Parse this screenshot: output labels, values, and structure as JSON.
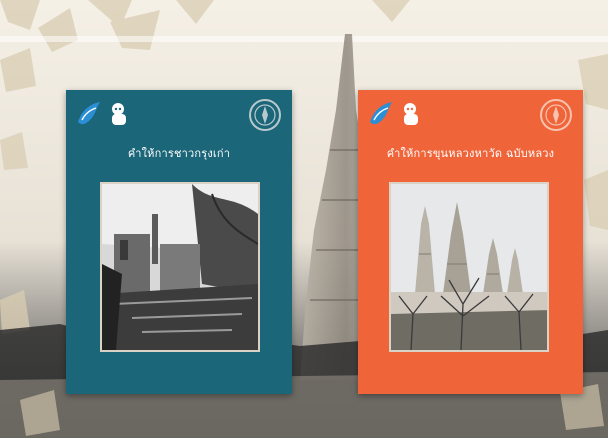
{
  "books": [
    {
      "title": "คำให้การชาวกรุงเก่า",
      "cover_color": "#1b6679",
      "icons": [
        "bird-logo-icon",
        "mascot-logo-icon",
        "seal-emblem-icon"
      ]
    },
    {
      "title": "คำให้การขุนหลวงหาวัด ฉบับหลวง",
      "cover_color": "#f0643a",
      "icons": [
        "bird-logo-icon",
        "mascot-logo-icon",
        "seal-emblem-icon"
      ]
    }
  ]
}
